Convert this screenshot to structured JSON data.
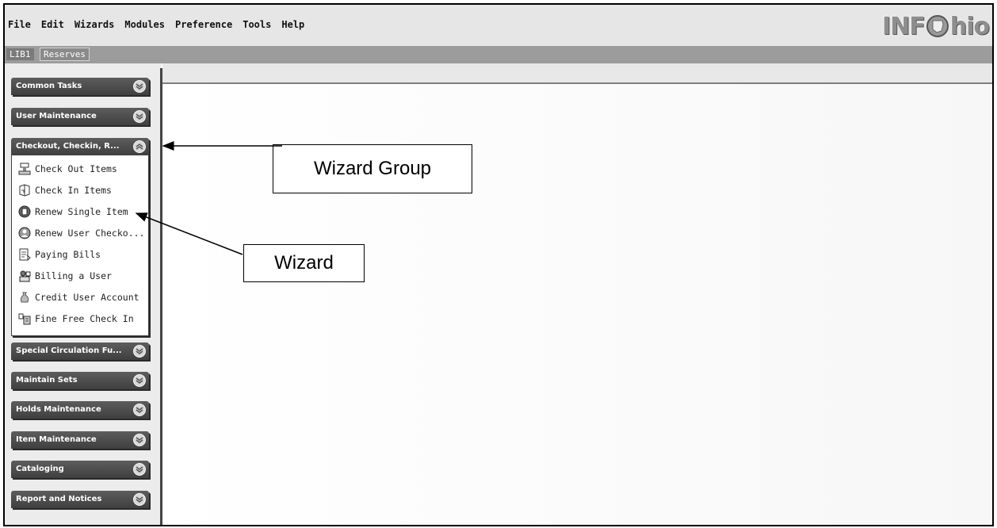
{
  "menu": [
    "File",
    "Edit",
    "Wizards",
    "Modules",
    "Preference",
    "Tools",
    "Help"
  ],
  "logo": {
    "text_left": "INF",
    "text_right": "hio"
  },
  "tabs": [
    "LIB1",
    "Reserves"
  ],
  "sidebar": {
    "groups_top": [
      "Common Tasks",
      "User Maintenance"
    ],
    "expanded_group": {
      "label": "Checkout, Checkin, R...",
      "wizards": [
        "Check Out Items",
        "Check In Items",
        "Renew Single Item",
        "Renew User Checko...",
        "Paying Bills",
        "Billing a User",
        "Credit User Account",
        "Fine Free Check In"
      ]
    },
    "groups_bottom": [
      "Special Circulation Fu...",
      "Maintain Sets",
      "Holds Maintenance",
      "Item Maintenance",
      "Cataloging",
      "Report and Notices"
    ]
  },
  "annotations": {
    "wizard_group": "Wizard Group",
    "wizard": "Wizard"
  },
  "colors": {
    "menubar": "#e6e6e6",
    "tabstrip": "#9c9c9c",
    "group_header": "#4a4a4a"
  }
}
